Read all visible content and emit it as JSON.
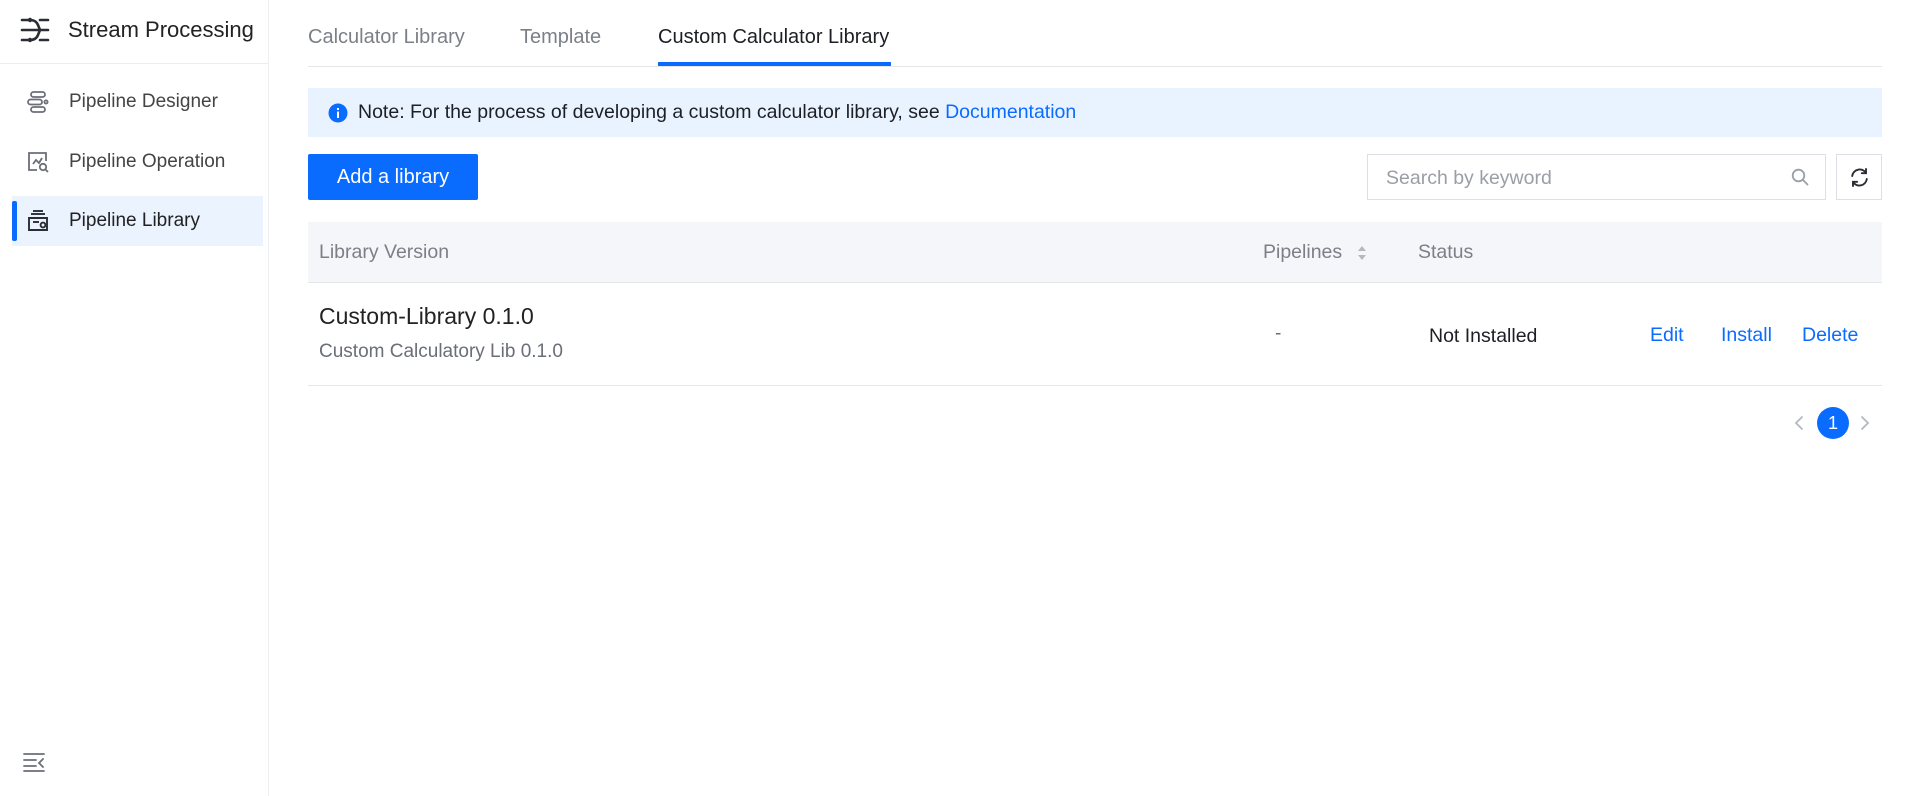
{
  "sidebar": {
    "title": "Stream Processing",
    "items": [
      {
        "label": "Pipeline Designer",
        "icon": "pipeline-designer-icon"
      },
      {
        "label": "Pipeline Operation",
        "icon": "pipeline-operation-icon"
      },
      {
        "label": "Pipeline Library",
        "icon": "pipeline-library-icon",
        "active": true
      }
    ]
  },
  "tabs": [
    {
      "label": "Calculator Library"
    },
    {
      "label": "Template"
    },
    {
      "label": "Custom Calculator Library",
      "active": true
    }
  ],
  "notice": {
    "text": "Note: For the process of developing a custom calculator library, see ",
    "link": "Documentation"
  },
  "toolbar": {
    "add_label": "Add a library",
    "search_placeholder": "Search by keyword"
  },
  "table": {
    "columns": {
      "version": "Library Version",
      "pipelines": "Pipelines",
      "status": "Status"
    },
    "rows": [
      {
        "name": "Custom-Library 0.1.0",
        "description": "Custom Calculatory Lib 0.1.0",
        "pipelines": "-",
        "status": "Not Installed",
        "actions": {
          "edit": "Edit",
          "install": "Install",
          "delete": "Delete"
        }
      }
    ]
  },
  "pagination": {
    "current_page": "1"
  },
  "colors": {
    "accent": "#0a6cff",
    "notice_bg": "#e9f3ff",
    "active_nav_bg": "#eaf3fe"
  }
}
